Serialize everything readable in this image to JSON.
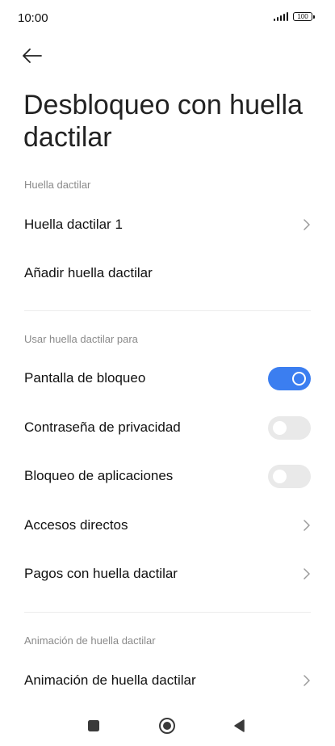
{
  "status": {
    "time": "10:00",
    "battery": "100"
  },
  "header": {
    "title": "Desbloqueo con huella dactilar"
  },
  "sections": {
    "fingerprint": {
      "header": "Huella dactilar",
      "fingerprint_1": "Huella dactilar 1",
      "add_fingerprint": "Añadir huella dactilar"
    },
    "usage": {
      "header": "Usar huella dactilar para",
      "lock_screen": {
        "label": "Pantalla de bloqueo",
        "enabled": true
      },
      "privacy_password": {
        "label": "Contraseña de privacidad",
        "enabled": false
      },
      "app_lock": {
        "label": "Bloqueo de aplicaciones",
        "enabled": false
      },
      "shortcuts": "Accesos directos",
      "payments": "Pagos con huella dactilar"
    },
    "animation": {
      "header": "Animación de huella dactilar",
      "animation_item": "Animación de huella dactilar"
    }
  },
  "icons": {
    "back": "back-arrow-icon",
    "chevron": "chevron-right-icon",
    "nav_recents": "square-icon",
    "nav_home": "circle-icon",
    "nav_back": "triangle-back-icon"
  },
  "colors": {
    "accent": "#3b7ef0",
    "toggle_off": "#e9e9e9"
  }
}
